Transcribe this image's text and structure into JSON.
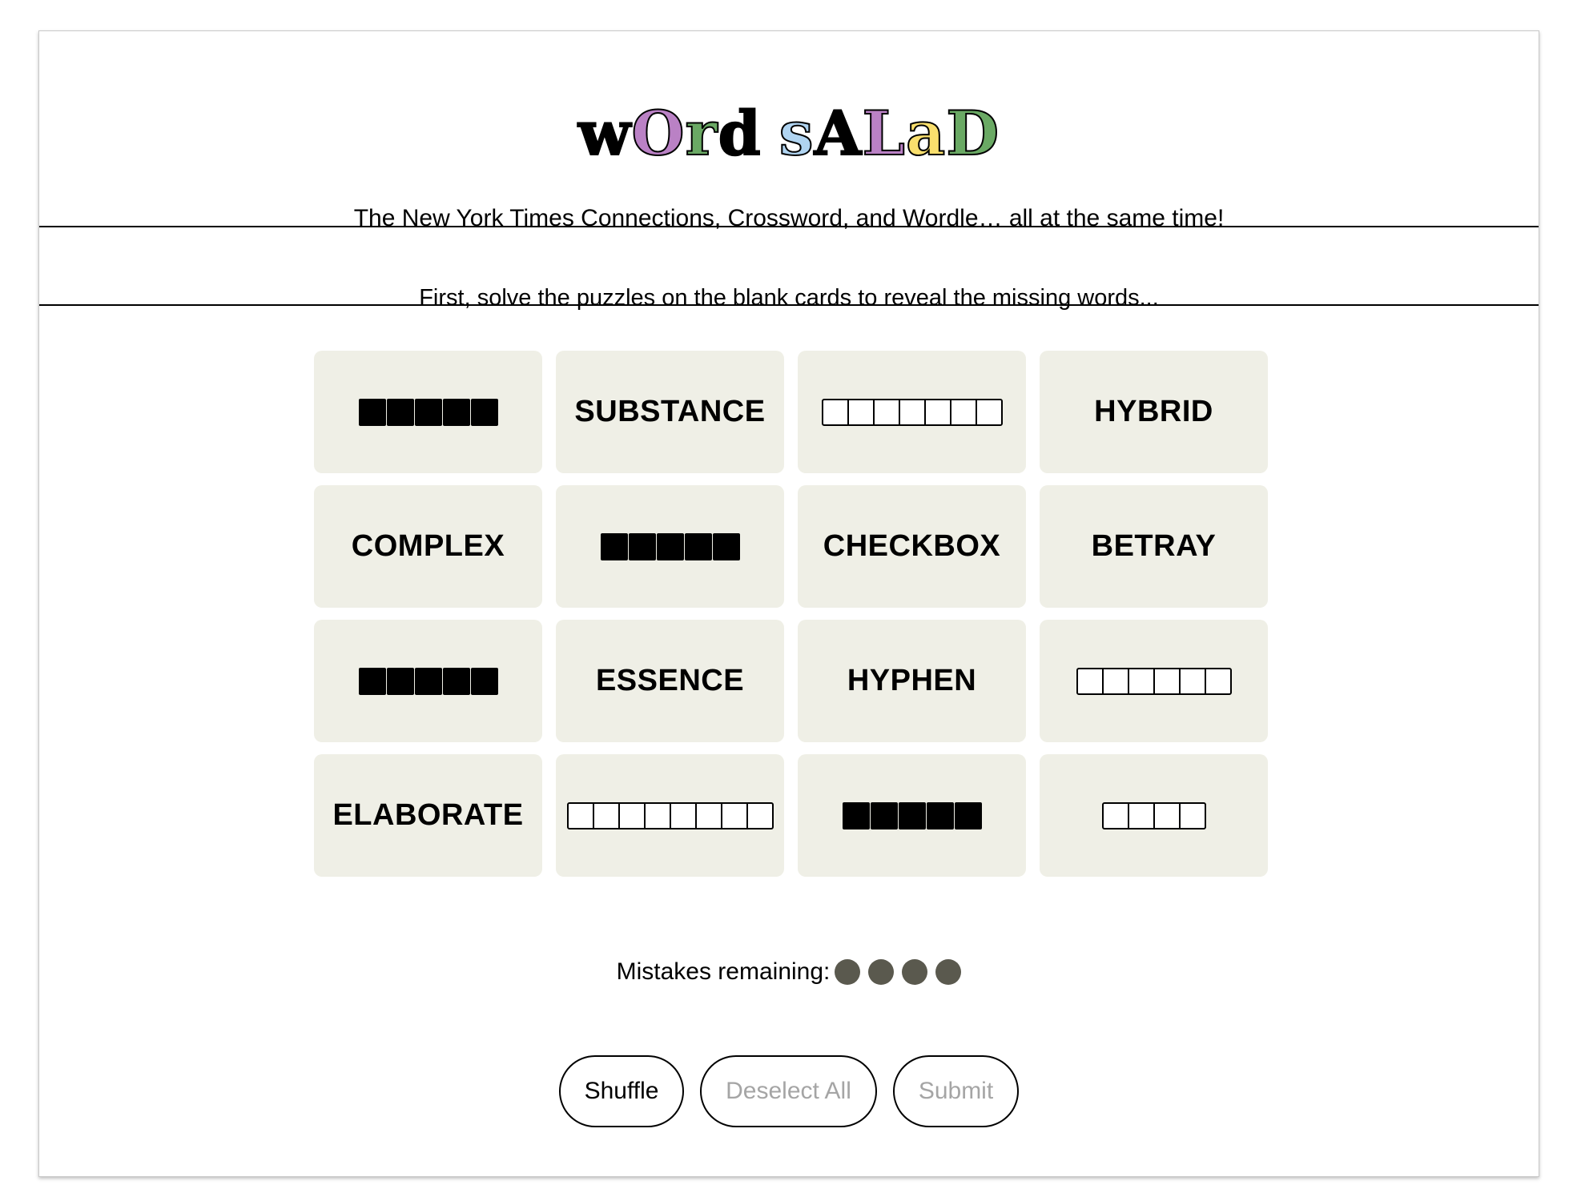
{
  "logo": {
    "letters": [
      {
        "char": "w",
        "color": "#000000"
      },
      {
        "char": "O",
        "color": "#ba81c5"
      },
      {
        "char": "r",
        "color": "#6aa964"
      },
      {
        "char": "d",
        "color": "#000000"
      },
      {
        "char": " ",
        "color": "#000000"
      },
      {
        "char": "s",
        "color": "#b0d4f1"
      },
      {
        "char": "A",
        "color": "#000000"
      },
      {
        "char": "L",
        "color": "#ba81c5"
      },
      {
        "char": "a",
        "color": "#f9df6d"
      },
      {
        "char": "D",
        "color": "#6aa964"
      }
    ]
  },
  "subtitle": "The New York Times Connections, Crossword, and Wordle… all at the same time!",
  "instruction": "First, solve the puzzles on the blank cards to reveal the missing words...",
  "cards": [
    {
      "type": "filled",
      "count": 5
    },
    {
      "type": "word",
      "text": "SUBSTANCE"
    },
    {
      "type": "empty",
      "count": 7
    },
    {
      "type": "word",
      "text": "HYBRID"
    },
    {
      "type": "word",
      "text": "COMPLEX"
    },
    {
      "type": "filled",
      "count": 5
    },
    {
      "type": "word",
      "text": "CHECKBOX"
    },
    {
      "type": "word",
      "text": "BETRAY"
    },
    {
      "type": "filled",
      "count": 5
    },
    {
      "type": "word",
      "text": "ESSENCE"
    },
    {
      "type": "word",
      "text": "HYPHEN"
    },
    {
      "type": "empty",
      "count": 6
    },
    {
      "type": "word",
      "text": "ELABORATE"
    },
    {
      "type": "empty",
      "count": 8
    },
    {
      "type": "filled",
      "count": 5
    },
    {
      "type": "empty",
      "count": 4
    }
  ],
  "mistakes": {
    "label": "Mistakes remaining:",
    "remaining": 4,
    "dot_color": "#5a594e"
  },
  "buttons": {
    "shuffle": "Shuffle",
    "deselect_all": "Deselect All",
    "submit": "Submit"
  }
}
